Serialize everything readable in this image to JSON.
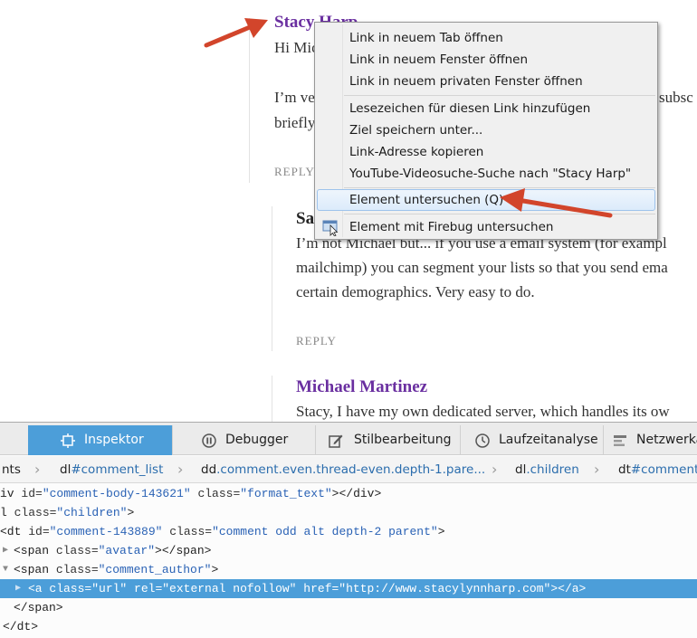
{
  "webpage": {
    "comment1": {
      "author": "Stacy Harp",
      "line1": "Hi Mic",
      "line2": "I’m ve",
      "line2_right": "subsc",
      "line3": "briefly",
      "reply": "REPLY"
    },
    "comment2": {
      "author": "Sa",
      "line1": "I’m not Michael but... if you use a email system (for exampl",
      "line2": "mailchimp) you can segment your lists so that you send ema",
      "line3": "certain demographics. Very easy to do.",
      "reply": "REPLY"
    },
    "comment3": {
      "author": "Michael Martinez",
      "line1": "Stacy, I have my own dedicated server, which handles its ow"
    }
  },
  "context_menu": {
    "group1": [
      "Link in neuem Tab öffnen",
      "Link in neuem Fenster öffnen",
      "Link in neuem privaten Fenster öffnen"
    ],
    "group2": [
      "Lesezeichen für diesen Link hinzufügen",
      "Ziel speichern unter...",
      "Link-Adresse kopieren",
      "YouTube-Videosuche-Suche nach \"Stacy Harp\""
    ],
    "inspect": "Element untersuchen (Q)",
    "firebug": "Element mit Firebug untersuchen"
  },
  "devtools": {
    "tabs": [
      {
        "label": "Inspektor",
        "icon": "inspector-icon",
        "active": true
      },
      {
        "label": "Debugger",
        "icon": "debugger-icon",
        "active": false
      },
      {
        "label": "Stilbearbeitung",
        "icon": "style-editor-icon",
        "active": false
      },
      {
        "label": "Laufzeitanalyse",
        "icon": "performance-icon",
        "active": false
      },
      {
        "label": "Netzwerka",
        "icon": "network-icon",
        "active": false
      }
    ],
    "breadcrumbs": [
      {
        "tag": "nts",
        "cls": ""
      },
      {
        "tag": "dl",
        "cls": "#comment_list"
      },
      {
        "tag": "dd",
        "cls": ".comment.even.thread-even.depth-1.pare..."
      },
      {
        "tag": "dl",
        "cls": ".children"
      },
      {
        "tag": "dt",
        "cls": "#comment"
      }
    ],
    "markup": {
      "l1": {
        "open": "iv ",
        "a1n": "id=",
        "a1v": "\"comment-body-143621\"",
        "a2n": " class=",
        "a2v": "\"format_text\"",
        "close": "></div>"
      },
      "l2": {
        "open": "l ",
        "a1n": "class=",
        "a1v": "\"children\"",
        "close": ">"
      },
      "l3": {
        "open": "<dt ",
        "a1n": "id=",
        "a1v": "\"comment-143889\"",
        "a2n": " class=",
        "a2v": "\"comment odd alt depth-2 parent\"",
        "close": ">"
      },
      "l4": {
        "open": "<span ",
        "a1n": "class=",
        "a1v": "\"avatar\"",
        "close": "></span>"
      },
      "l5": {
        "open": "<span ",
        "a1n": "class=",
        "a1v": "\"comment_author\"",
        "close": ">"
      },
      "l6": {
        "open": "<a ",
        "a1n": "class=",
        "a1v": "\"url\"",
        "a2n": " rel=",
        "a2v": "\"external nofollow\"",
        "a3n": " href=",
        "a3v": "\"http://www.stacylynnharp.com\"",
        "close": "></a>"
      },
      "l7": {
        "text": "</span>"
      },
      "l8": {
        "text": "</dt>"
      }
    }
  },
  "colors": {
    "author": "#6a2fa0",
    "devtools_accent": "#4c9ed9",
    "annotation_arrow": "#d2452b"
  }
}
